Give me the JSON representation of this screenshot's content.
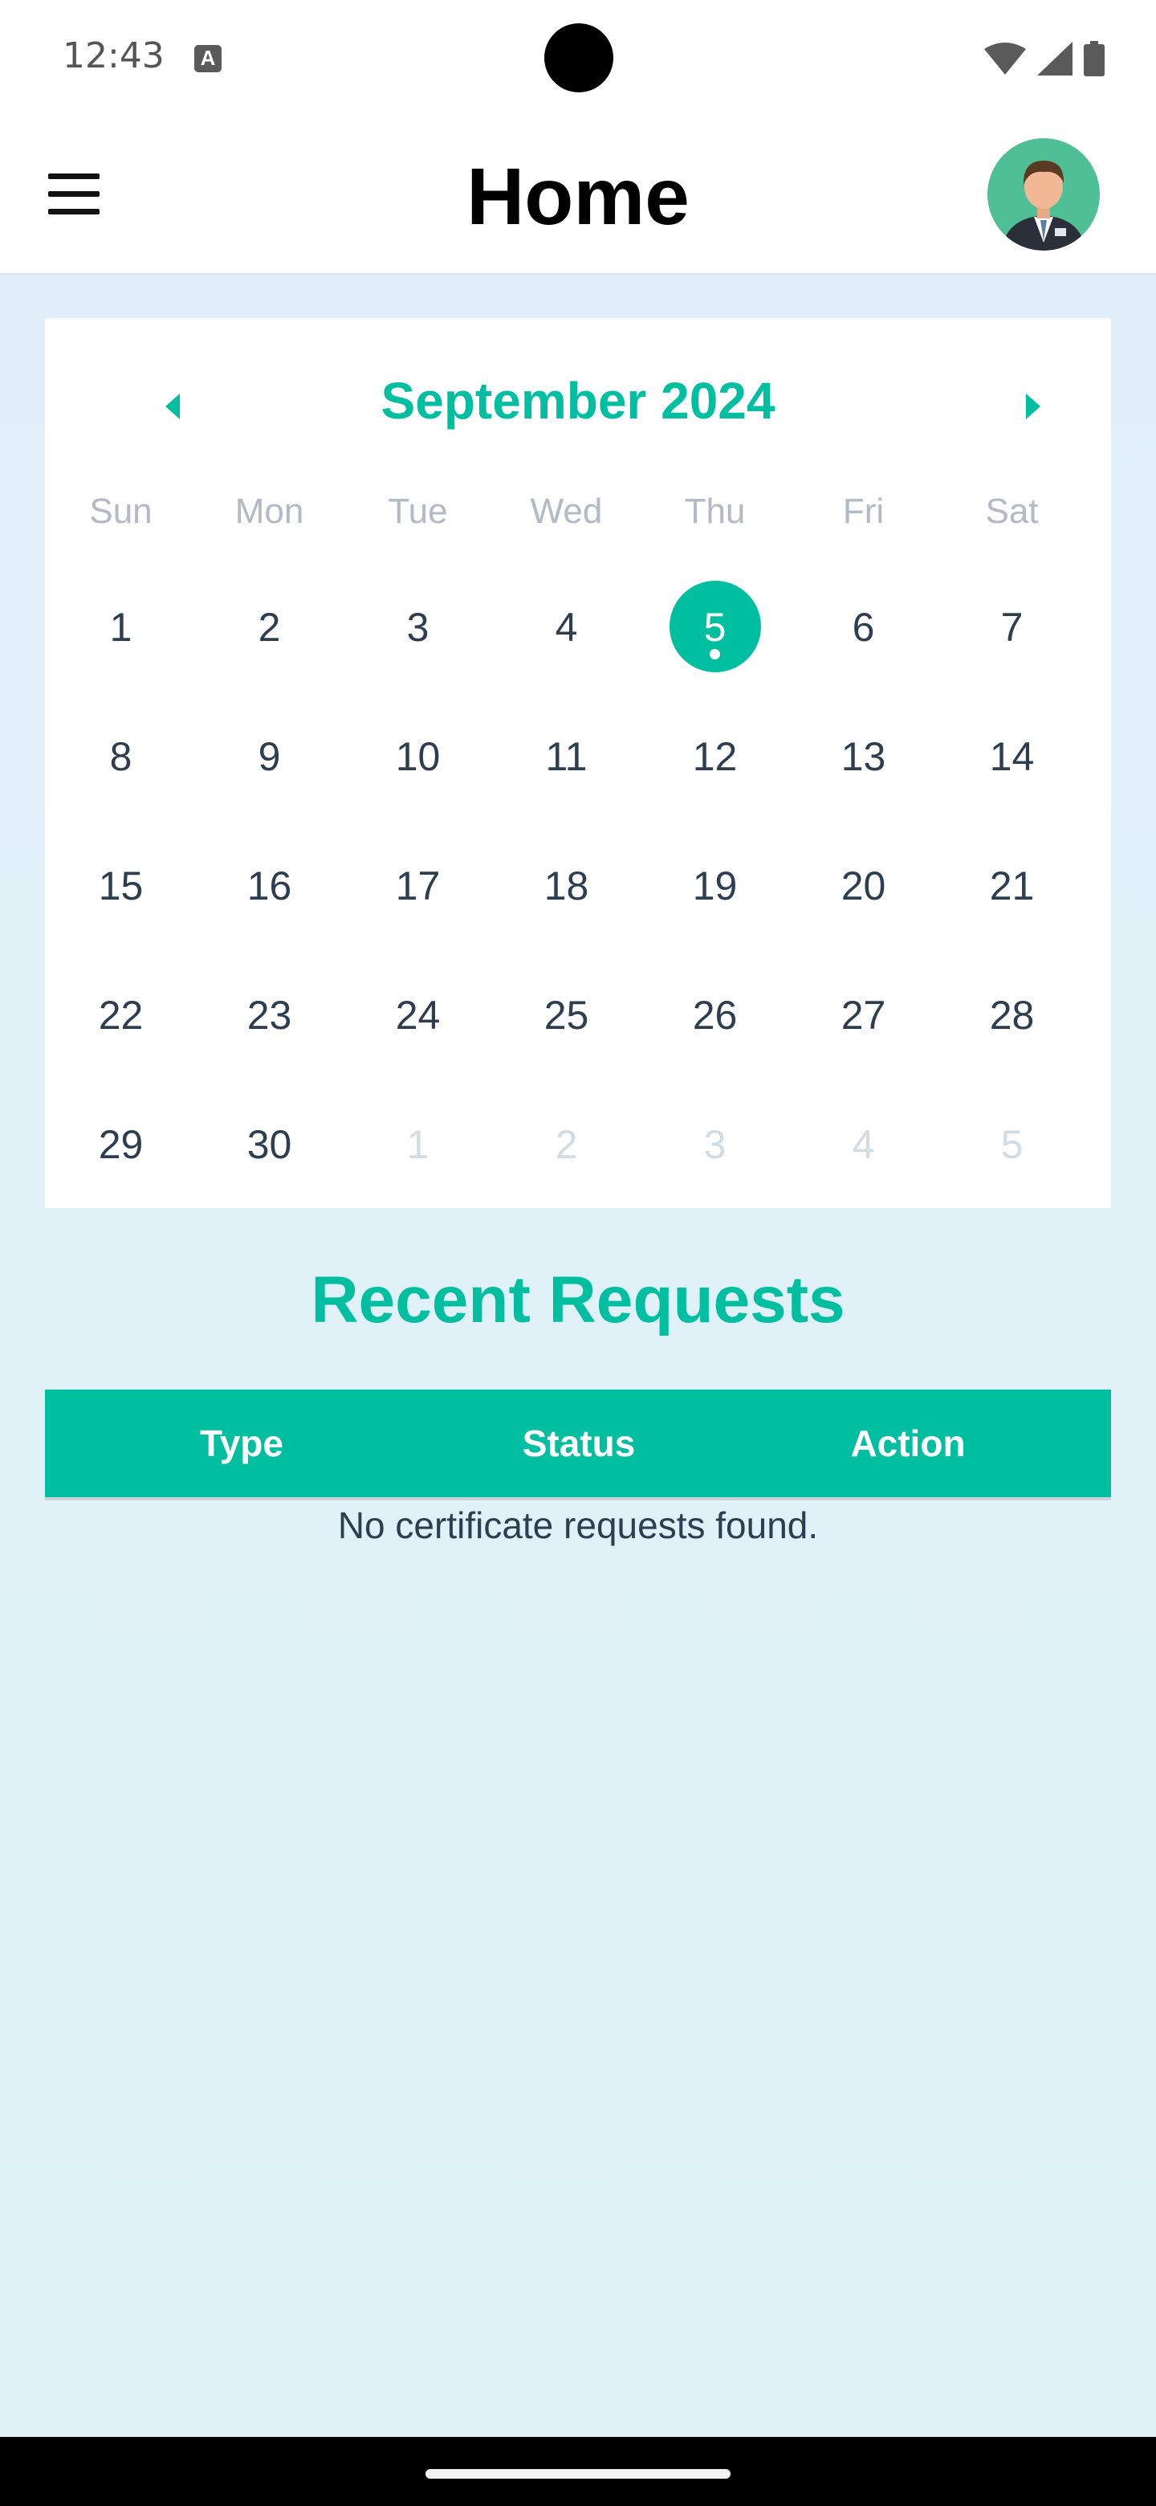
{
  "status_bar": {
    "time": "12:43",
    "notification_icon": "a-icon"
  },
  "header": {
    "title": "Home",
    "menu_icon": "hamburger-menu-icon",
    "avatar_icon": "user-avatar-icon"
  },
  "calendar": {
    "month_label": "September 2024",
    "weekdays": [
      "Sun",
      "Mon",
      "Tue",
      "Wed",
      "Thu",
      "Fri",
      "Sat"
    ],
    "days": [
      {
        "label": "1",
        "muted": false
      },
      {
        "label": "2",
        "muted": false
      },
      {
        "label": "3",
        "muted": false
      },
      {
        "label": "4",
        "muted": false
      },
      {
        "label": "5",
        "muted": false,
        "selected": true
      },
      {
        "label": "6",
        "muted": false
      },
      {
        "label": "7",
        "muted": false
      },
      {
        "label": "8",
        "muted": false
      },
      {
        "label": "9",
        "muted": false
      },
      {
        "label": "10",
        "muted": false
      },
      {
        "label": "11",
        "muted": false
      },
      {
        "label": "12",
        "muted": false
      },
      {
        "label": "13",
        "muted": false
      },
      {
        "label": "14",
        "muted": false
      },
      {
        "label": "15",
        "muted": false
      },
      {
        "label": "16",
        "muted": false
      },
      {
        "label": "17",
        "muted": false
      },
      {
        "label": "18",
        "muted": false
      },
      {
        "label": "19",
        "muted": false
      },
      {
        "label": "20",
        "muted": false
      },
      {
        "label": "21",
        "muted": false
      },
      {
        "label": "22",
        "muted": false
      },
      {
        "label": "23",
        "muted": false
      },
      {
        "label": "24",
        "muted": false
      },
      {
        "label": "25",
        "muted": false
      },
      {
        "label": "26",
        "muted": false
      },
      {
        "label": "27",
        "muted": false
      },
      {
        "label": "28",
        "muted": false
      },
      {
        "label": "29",
        "muted": false
      },
      {
        "label": "30",
        "muted": false
      },
      {
        "label": "1",
        "muted": true
      },
      {
        "label": "2",
        "muted": true
      },
      {
        "label": "3",
        "muted": true
      },
      {
        "label": "4",
        "muted": true
      },
      {
        "label": "5",
        "muted": true
      }
    ]
  },
  "recent_requests": {
    "title": "Recent Requests",
    "columns": [
      "Type",
      "Status",
      "Action"
    ],
    "empty_message": "No certificate requests found."
  },
  "colors": {
    "accent": "#00bfa0",
    "text": "#2c3e50",
    "muted": "#b3b9c6",
    "avatar_bg": "#4fbf96"
  }
}
